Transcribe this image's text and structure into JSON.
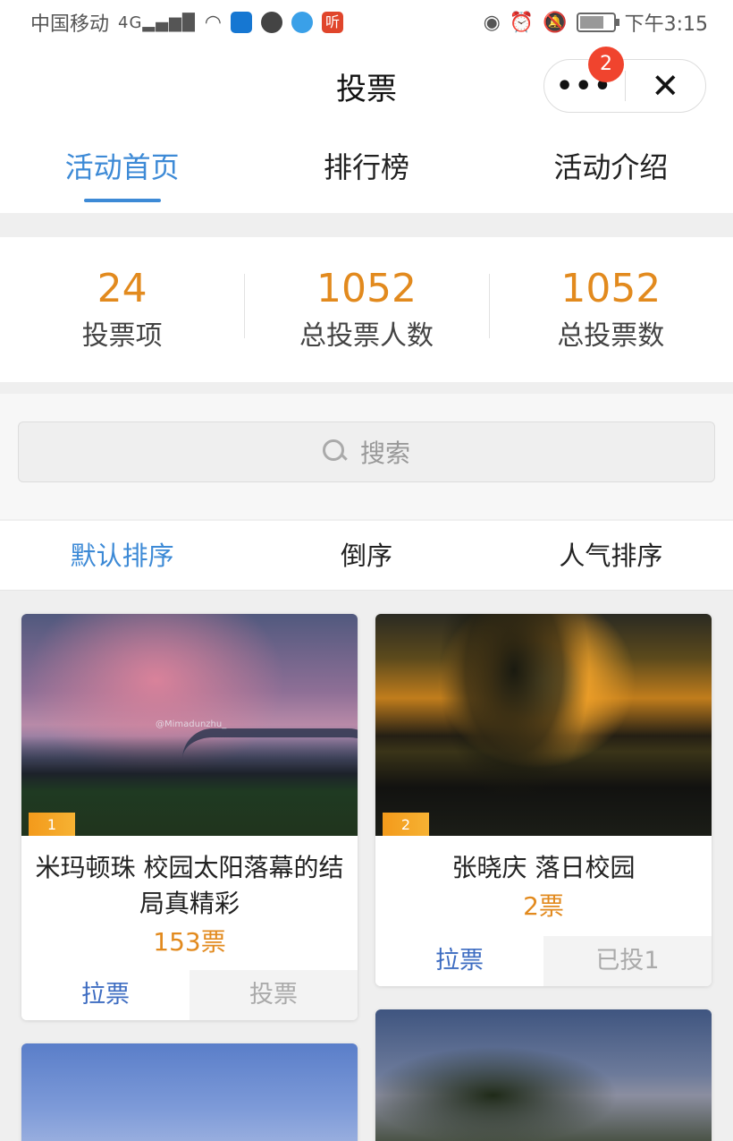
{
  "status_bar": {
    "carrier": "中国移动",
    "network": "4G",
    "time": "下午3:15",
    "app_icon_text": "听"
  },
  "nav": {
    "title": "投票",
    "more_icon": "more-dots-icon",
    "close_icon": "close-icon",
    "badge_count": "2"
  },
  "tabs": [
    {
      "label": "活动首页",
      "active": true
    },
    {
      "label": "排行榜",
      "active": false
    },
    {
      "label": "活动介绍",
      "active": false
    }
  ],
  "stats": [
    {
      "value": "24",
      "label": "投票项"
    },
    {
      "value": "1052",
      "label": "总投票人数"
    },
    {
      "value": "1052",
      "label": "总投票数"
    }
  ],
  "search": {
    "placeholder": "搜索"
  },
  "sort": [
    {
      "label": "默认排序",
      "active": true
    },
    {
      "label": "倒序",
      "active": false
    },
    {
      "label": "人气排序",
      "active": false
    }
  ],
  "cards": [
    {
      "rank": "1",
      "title": "米玛顿珠 校园太阳落幕的结局真精彩",
      "votes": "153票",
      "watermark": "@Mimadunzhu_",
      "pull_label": "拉票",
      "vote_label": "投票"
    },
    {
      "rank": "2",
      "title": "张晓庆 落日校园",
      "votes": "2票",
      "pull_label": "拉票",
      "vote_label": "已投1"
    }
  ],
  "colors": {
    "accent_blue": "#3d8ad6",
    "orange": "#e28a1e",
    "badge_red": "#f0442e"
  }
}
